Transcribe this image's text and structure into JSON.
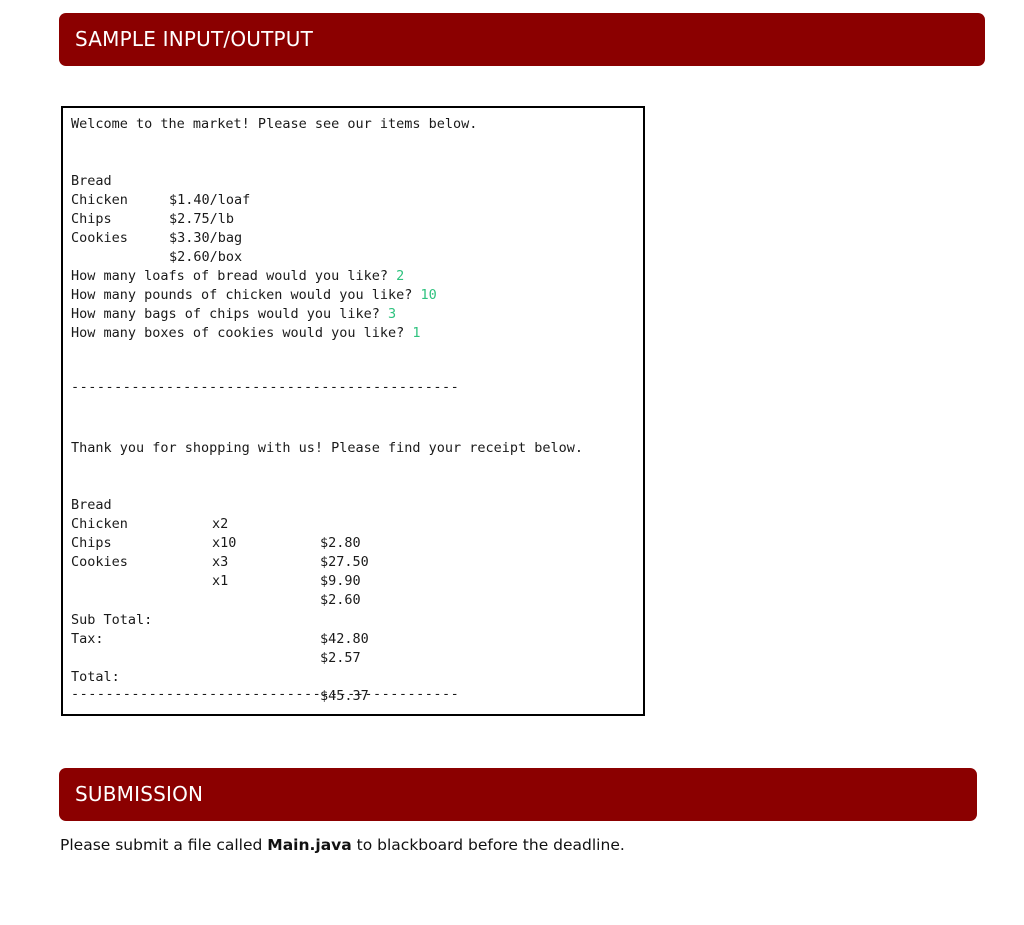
{
  "sections": {
    "sample_title": "SAMPLE INPUT/OUTPUT",
    "submission_title": "SUBMISSION"
  },
  "console": {
    "welcome": "Welcome to the market! Please see our items below.",
    "menu": [
      {
        "item": "Bread",
        "price": "$1.40/loaf"
      },
      {
        "item": "Chicken",
        "price": "$2.75/lb"
      },
      {
        "item": "Chips",
        "price": "$3.30/bag"
      },
      {
        "item": "Cookies",
        "price": "$2.60/box"
      }
    ],
    "questions": [
      {
        "prompt": "How many loafs of bread would you like? ",
        "answer": "2"
      },
      {
        "prompt": "How many pounds of chicken would you like? ",
        "answer": "10"
      },
      {
        "prompt": "How many bags of chips would you like? ",
        "answer": "3"
      },
      {
        "prompt": "How many boxes of cookies would you like? ",
        "answer": "1"
      }
    ],
    "separator": "---------------------------------------------",
    "thanks": "Thank you for shopping with us! Please find your receipt below.",
    "receipt": [
      {
        "item": "Bread",
        "qty": "x2",
        "cost": "$2.80"
      },
      {
        "item": "Chicken",
        "qty": "x10",
        "cost": "$27.50"
      },
      {
        "item": "Chips",
        "qty": "x3",
        "cost": "$9.90"
      },
      {
        "item": "Cookies",
        "qty": "x1",
        "cost": "$2.60"
      }
    ],
    "subtotal_label": "Sub Total:",
    "subtotal_value": "$42.80",
    "tax_label": "Tax:",
    "tax_value": "$2.57",
    "total_label": "Total:",
    "total_value": "$45.37"
  },
  "submission": {
    "before": "Please submit a file called ",
    "filename": "Main.java",
    "after": " to blackboard before the deadline."
  },
  "colors": {
    "header_bg": "#8b0000",
    "input_green": "#2ec27e"
  }
}
